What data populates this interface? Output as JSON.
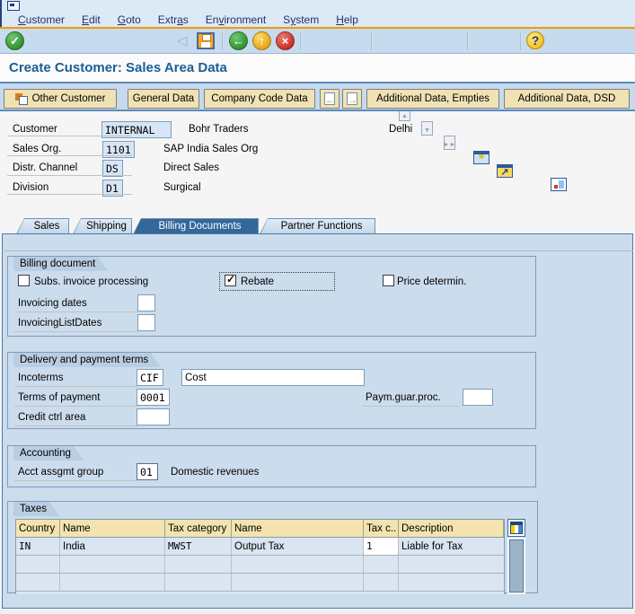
{
  "colors": {
    "accent_orange": "#ee9c00",
    "title_blue": "#1b5e94",
    "tab_active_blue": "#34689a",
    "button_tan": "#f0e2b4",
    "panel_blue": "#cbdcec"
  },
  "menu": {
    "items": [
      {
        "pre": "",
        "accel": "C",
        "post": "ustomer"
      },
      {
        "pre": "",
        "accel": "E",
        "post": "dit"
      },
      {
        "pre": "",
        "accel": "G",
        "post": "oto"
      },
      {
        "pre": "Extr",
        "accel": "a",
        "post": "s"
      },
      {
        "pre": "En",
        "accel": "v",
        "post": "ironment"
      },
      {
        "pre": "S",
        "accel": "y",
        "post": "stem"
      },
      {
        "pre": "",
        "accel": "H",
        "post": "elp"
      }
    ]
  },
  "toolbar": {
    "command_value": ""
  },
  "icons": {
    "enter": "✓",
    "command_history": "≡",
    "collapse": "◁",
    "back": "←",
    "exit": "↑",
    "cancel": "×",
    "find_plus": "+",
    "page_first": "◄◄",
    "page_prev": "▲",
    "page_next": "▼",
    "page_last": "►►",
    "new_session_star": "*",
    "shortcut_arrow": "↗",
    "help": "?",
    "app_prev_arrow": "←",
    "app_next_arrow": "→"
  },
  "title": "Create Customer: Sales Area Data",
  "app_toolbar": {
    "other_customer": "Other Customer",
    "general_data": "General Data",
    "company_code_data": "Company Code Data",
    "additional_empties": "Additional Data, Empties",
    "additional_dsd": "Additional Data, DSD"
  },
  "header": {
    "rows": [
      {
        "label": "Customer",
        "value": "INTERNAL",
        "desc": "Bohr Traders",
        "extra": "Delhi"
      },
      {
        "label": "Sales Org.",
        "value": "1101",
        "desc": "SAP India Sales Org",
        "extra": ""
      },
      {
        "label": "Distr. Channel",
        "value": "DS",
        "desc": "Direct Sales",
        "extra": ""
      },
      {
        "label": "Division",
        "value": "D1",
        "desc": "Surgical",
        "extra": ""
      }
    ]
  },
  "tabs": {
    "items": [
      {
        "label": "Sales"
      },
      {
        "label": "Shipping"
      },
      {
        "label": "Billing Documents"
      },
      {
        "label": "Partner Functions"
      }
    ]
  },
  "billing": {
    "title": "Billing document",
    "cb_subs": "Subs. invoice processing",
    "cb_rebate": "Rebate",
    "cb_price": "Price determin.",
    "invoicing_dates": "Invoicing dates",
    "invoicing_dates_value": "",
    "invoicing_list": "InvoicingListDates",
    "invoicing_list_value": ""
  },
  "delivery": {
    "title": "Delivery and payment terms",
    "incoterms": "Incoterms",
    "incoterms_value": "CIF",
    "incoterms_text": "Cost",
    "terms": "Terms of payment",
    "terms_value": "0001",
    "paym": "Paym.guar.proc.",
    "paym_value": "",
    "credit": "Credit ctrl area",
    "credit_value": ""
  },
  "accounting": {
    "title": "Accounting",
    "label": "Acct assgmt group",
    "value": "01",
    "desc": "Domestic revenues"
  },
  "taxes": {
    "title": "Taxes",
    "columns": [
      "Country",
      "Name",
      "Tax category",
      "Name",
      "Tax c..",
      "Description"
    ],
    "rows": [
      [
        "IN",
        "India",
        "MWST",
        "Output Tax",
        "1",
        "Liable for Tax"
      ]
    ]
  }
}
